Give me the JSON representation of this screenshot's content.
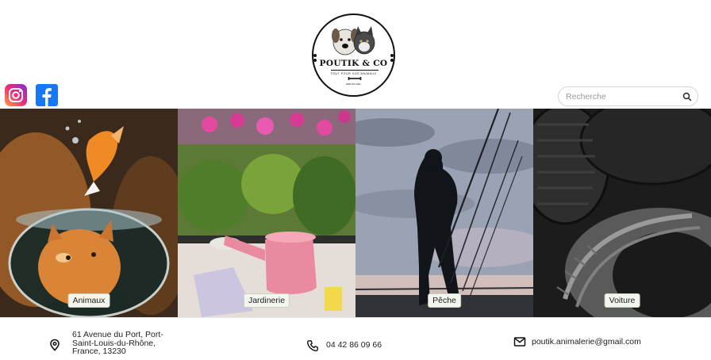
{
  "header": {
    "logo": {
      "brand": "POUTIK & CO",
      "tagline": "TOUT POUR VOS ANIMAUX",
      "since": "DEPUIS 2021"
    },
    "social": [
      {
        "name": "instagram-icon",
        "color": "#ee2a7b"
      },
      {
        "name": "facebook-icon",
        "color": "#1877f2"
      }
    ],
    "search": {
      "placeholder": "Recherche",
      "value": ""
    }
  },
  "categories": [
    {
      "label": "Animaux"
    },
    {
      "label": "Jardinerie"
    },
    {
      "label": "Pêche"
    },
    {
      "label": "Voiture"
    }
  ],
  "footer": {
    "address": {
      "line1": "61 Avenue du Port, Port-",
      "line2": "Saint-Louis-du-Rhône,",
      "line3": "France, 13230"
    },
    "phone": "04 42 86 09 66",
    "email": "poutik.animalerie@gmail.com"
  },
  "colors": {
    "label_bg": "#f3f5ef",
    "label_border": "#c9d1c0",
    "facebook": "#1877f2"
  }
}
